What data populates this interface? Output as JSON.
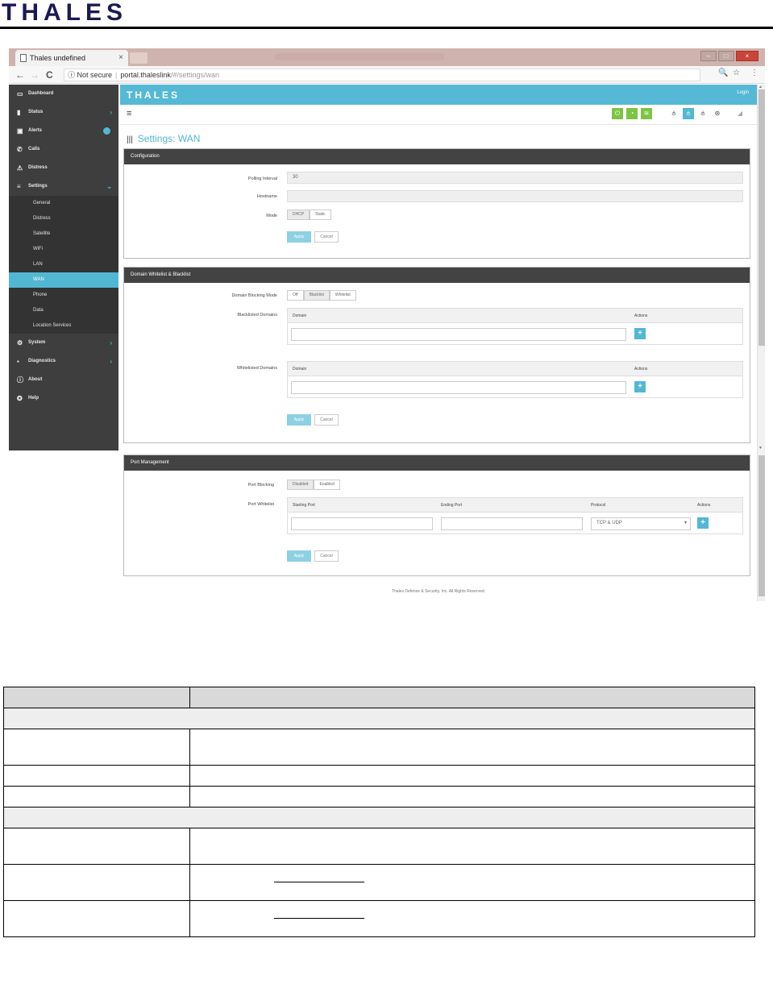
{
  "document": {
    "logo_text": "THALES"
  },
  "browser": {
    "tab_title": "Thales undefined",
    "tab_close": "×",
    "window_controls": [
      "–",
      "□",
      "×"
    ],
    "nav": {
      "back": "←",
      "forward": "→",
      "reload": "C"
    },
    "security_label": "ⓘ Not secure",
    "url_host": "portal.thaleslink",
    "url_path": "/#/settings/wan",
    "zoom_icon": "🔍",
    "bookmark_icon": "☆",
    "menu_icon": "⋮"
  },
  "sidebar": {
    "items": [
      {
        "label": "Dashboard",
        "icon": "monitor-icon",
        "glyph": "▭"
      },
      {
        "label": "Status",
        "icon": "bar-chart-icon",
        "glyph": "▮",
        "chevron": "›"
      },
      {
        "label": "Alerts",
        "icon": "calendar-icon",
        "glyph": "▣",
        "badge": true
      },
      {
        "label": "Calls",
        "icon": "phone-icon",
        "glyph": "✆"
      },
      {
        "label": "Distress",
        "icon": "warning-icon",
        "glyph": "⚠"
      },
      {
        "label": "Settings",
        "icon": "sliders-icon",
        "glyph": "≡",
        "chevron": "⌄"
      }
    ],
    "settings_sub": [
      {
        "label": "General",
        "active": false
      },
      {
        "label": "Distress",
        "active": false
      },
      {
        "label": "Satellite",
        "active": false
      },
      {
        "label": "WiFi",
        "active": false
      },
      {
        "label": "LAN",
        "active": false
      },
      {
        "label": "WAN",
        "active": true
      },
      {
        "label": "Phone",
        "active": false
      },
      {
        "label": "Data",
        "active": false
      },
      {
        "label": "Location Services",
        "active": false
      }
    ],
    "items_after": [
      {
        "label": "System",
        "icon": "gear-icon",
        "glyph": "⚙",
        "chevron": "›"
      },
      {
        "label": "Diagnostics",
        "icon": "toolbox-icon",
        "glyph": "▪",
        "chevron": "›"
      },
      {
        "label": "About",
        "icon": "info-icon",
        "glyph": "ⓘ"
      },
      {
        "label": "Help",
        "icon": "lifebuoy-icon",
        "glyph": "✪"
      }
    ]
  },
  "app": {
    "logo": "THALES",
    "login": "Login",
    "menu_glyph": "≡",
    "toolbar_icons": [
      "power-icon",
      "rss-icon",
      "wifi-icon",
      "network-icon",
      "network-active-icon",
      "network-alt-icon",
      "globe-icon",
      "signal-icon"
    ],
    "page_title": "Settings: WAN",
    "title_glyph": "|||",
    "footer": "Thales Defense & Security, Inc. All Rights Reserved."
  },
  "configuration": {
    "heading": "Configuration",
    "polling_label": "Polling Interval",
    "polling_value": "30",
    "hostname_label": "Hostname",
    "hostname_value": "",
    "mode_label": "Mode",
    "mode_options": [
      "DHCP",
      "Static"
    ],
    "apply": "Apply",
    "cancel": "Cancel"
  },
  "domain_lists": {
    "heading": "Domain Whitelist & Blacklist",
    "blocking_label": "Domain Blocking Mode",
    "blocking_options": [
      "Off",
      "Blacklist",
      "Whitelist"
    ],
    "blacklisted_label": "Blacklisted Domains",
    "whitelisted_label": "Whitelisted Domains",
    "col_domain": "Domain",
    "col_actions": "Actions",
    "plus": "+",
    "apply": "Apply",
    "cancel": "Cancel"
  },
  "port_management": {
    "heading": "Port Management",
    "port_blocking_label": "Port Blocking",
    "port_blocking_options": [
      "Disabled",
      "Enabled"
    ],
    "port_whitelist_label": "Port Whitelist",
    "col_starting_port": "Starting Port",
    "col_ending_port": "Ending Port",
    "col_protocol": "Protocol",
    "col_actions": "Actions",
    "protocol_value": "TCP & UDP",
    "select_arrow": "▾",
    "plus": "+",
    "apply": "Apply",
    "cancel": "Cancel"
  }
}
